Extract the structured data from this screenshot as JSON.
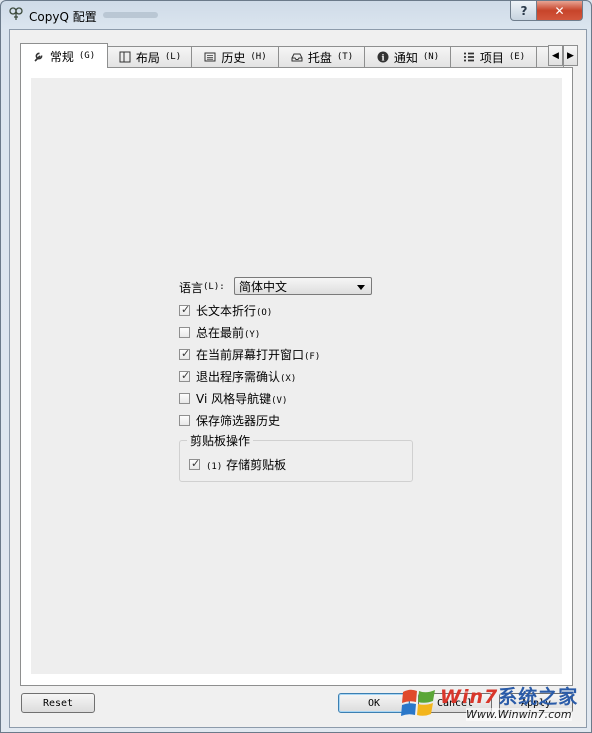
{
  "window": {
    "title": "CopyQ 配置",
    "help_label": "?",
    "close_label": "✕"
  },
  "tabs": [
    {
      "label": "常规",
      "accel": "(G)",
      "icon": "wrench-icon"
    },
    {
      "label": "布局",
      "accel": "(L)",
      "icon": "layout-icon"
    },
    {
      "label": "历史",
      "accel": "(H)",
      "icon": "history-icon"
    },
    {
      "label": "托盘",
      "accel": "(T)",
      "icon": "tray-icon"
    },
    {
      "label": "通知",
      "accel": "(N)",
      "icon": "info-icon"
    },
    {
      "label": "项目",
      "accel": "(E)",
      "icon": "list-icon"
    }
  ],
  "tab_scroll": {
    "left": "◀",
    "right": "▶"
  },
  "general": {
    "language_label": "语言",
    "language_accel": "(L):",
    "language_value": "简体中文",
    "options": [
      {
        "label": "长文本折行",
        "accel": "(O)",
        "checked": true,
        "mark": "✓"
      },
      {
        "label": "总在最前",
        "accel": "(Y)",
        "checked": false,
        "mark": ""
      },
      {
        "label": "在当前屏幕打开窗口",
        "accel": "(F)",
        "checked": true,
        "mark": "✓"
      },
      {
        "label": "退出程序需确认",
        "accel": "(X)",
        "checked": true,
        "mark": "✓"
      },
      {
        "label": "Vi 风格导航键",
        "accel": "(V)",
        "checked": false,
        "mark": ""
      },
      {
        "label": "保存筛选器历史",
        "accel": "",
        "checked": false,
        "mark": ""
      }
    ],
    "clipboard_group": {
      "title": "剪贴板操作",
      "option": {
        "accel": "(1)",
        "label": "存储剪贴板",
        "checked": true,
        "mark": "✓"
      }
    }
  },
  "buttons": {
    "reset": "Reset",
    "ok": "OK",
    "cancel": "Cancel",
    "apply": "Apply"
  },
  "watermark": {
    "brand_w": "Win",
    "brand_7": "7",
    "brand_cn": "系统之家",
    "url": "Www.Winwin7.com"
  }
}
